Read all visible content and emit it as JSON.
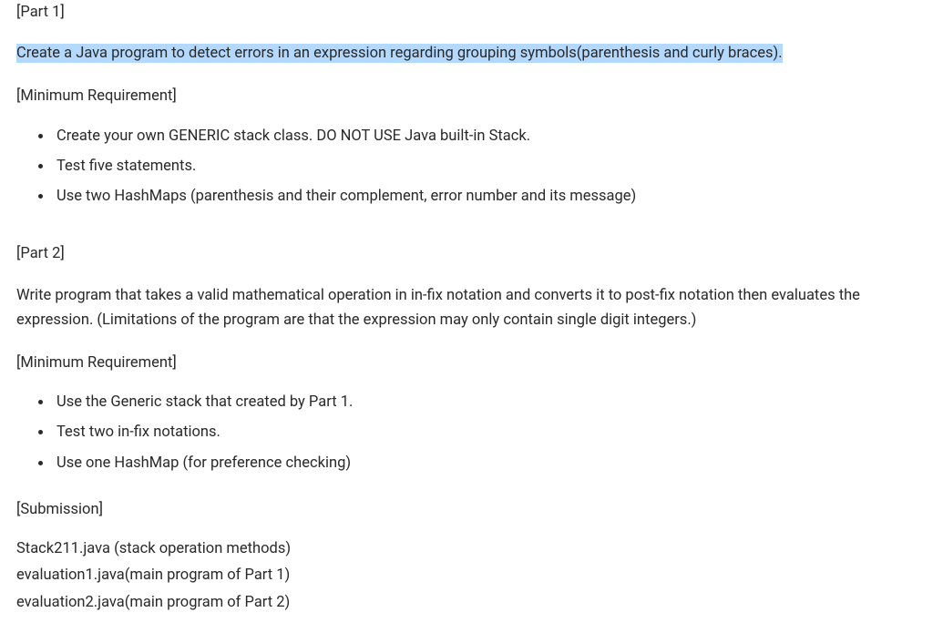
{
  "part1": {
    "label": "[Part 1]",
    "description": "Create a Java program to detect errors in an expression regarding grouping symbols(parenthesis and curly braces).",
    "min_req_label": "[Minimum Requirement]",
    "requirements": [
      "Create your own GENERIC stack class. DO NOT USE Java built-in Stack.",
      "Test five statements.",
      "Use two HashMaps (parenthesis and their complement, error number and its message)"
    ]
  },
  "part2": {
    "label": "[Part 2]",
    "description": "Write program that takes a valid mathematical operation in in-fix notation and converts it to post-fix notation then evaluates the expression. (Limitations of the program are that the expression may only contain single digit integers.)",
    "min_req_label": "[Minimum Requirement]",
    "requirements": [
      "Use the Generic stack that created by Part 1.",
      "Test two in-fix notations.",
      "Use one HashMap (for preference checking)"
    ]
  },
  "submission": {
    "label": "[Submission]",
    "files": [
      "Stack211.java (stack operation methods)",
      "evaluation1.java(main program of Part 1)",
      "evaluation2.java(main program of Part 2)"
    ]
  }
}
